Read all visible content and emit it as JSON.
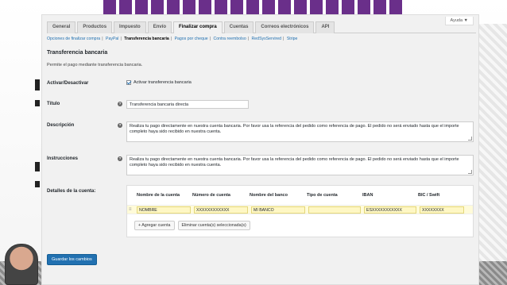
{
  "help_tab": "Ayuda ▼",
  "tabs": [
    "General",
    "Productos",
    "Impuesto",
    "Envío",
    "Finalizar compra",
    "Cuentas",
    "Correos electrónicos",
    "API"
  ],
  "active_tab": "Finalizar compra",
  "subnav": [
    "Opciones de finalizar compra",
    "PayPal",
    "Transferencia bancaria",
    "Pagos por cheque",
    "Contra reembolso",
    "RedSysServired",
    "Stripe"
  ],
  "subnav_current": "Transferencia bancaria",
  "section": {
    "title": "Transferencia bancaria",
    "description": "Permite el pago mediante transferencia bancaria."
  },
  "fields": {
    "enable": {
      "label": "Activar/Desactivar",
      "checkbox_label": "Activar transferencia bancaria",
      "checked": true
    },
    "title": {
      "label": "Título",
      "help": "?",
      "value": "Transferencia bancaria directa"
    },
    "description": {
      "label": "Descripción",
      "help": "?",
      "value": "Realiza tu pago directamente en nuestra cuenta bancaria. Por favor usa la referencia del pedido como referencia de pago. El pedido no será enviado hasta que el importe completo haya sido recibido en nuestra cuenta."
    },
    "instructions": {
      "label": "Instrucciones",
      "help": "?",
      "value": "Realiza tu pago directamente en nuestra cuenta bancaria. Por favor usa la referencia del pedido como referencia de pago. El pedido no será enviado hasta que el importe completo haya sido recibido en nuestra cuenta."
    }
  },
  "account_details": {
    "label": "Detalles de la cuenta:",
    "headers": [
      "Nombre de la cuenta",
      "Número de cuenta",
      "Nombre del banco",
      "Tipo de cuenta",
      "IBAN",
      "BIC / Swift"
    ],
    "rows": [
      [
        "NOMBRE",
        "XXXXXXXXXXXX",
        "MI BANCO",
        "",
        "ESXXXXXXXXXXX",
        "XXXXXXXX"
      ]
    ],
    "handle": "≡",
    "add_button": "+ Agregar cuenta",
    "remove_button": "Eliminar cuenta(s) seleccionada(s)"
  },
  "save_button": "Guardar los cambios",
  "colors": {
    "primary": "#2271b1",
    "brand_purple": "#6a2f8a",
    "row_highlight": "#fffbd9"
  }
}
